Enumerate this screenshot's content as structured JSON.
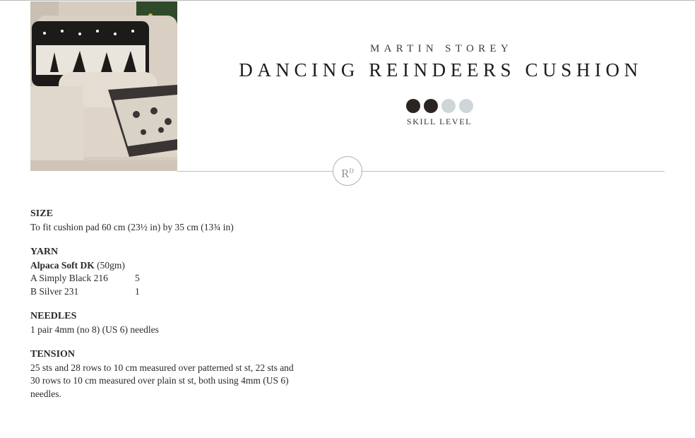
{
  "header": {
    "author": "MARTIN STOREY",
    "title": "DANCING REINDEERS CUSHION",
    "skill_level_label": "SKILL LEVEL",
    "skill_level": 2,
    "skill_level_max": 4
  },
  "logo": {
    "text": "R",
    "superscript": "D"
  },
  "size": {
    "heading": "SIZE",
    "text": "To fit cushion pad 60 cm (23½ in) by 35 cm (13¾ in)"
  },
  "yarn": {
    "heading": "YARN",
    "product": "Alpaca Soft DK",
    "weight": "(50gm)",
    "colors": [
      {
        "name": "A  Simply Black 216",
        "qty": "5"
      },
      {
        "name": "B  Silver 231",
        "qty": "1"
      }
    ]
  },
  "needles": {
    "heading": "NEEDLES",
    "text": "1 pair 4mm (no 8) (US 6) needles"
  },
  "tension": {
    "heading": "TENSION",
    "line1": "25 sts and 28 rows to 10 cm measured over patterned st st, 22 sts and",
    "line2": "30 rows to 10 cm measured over plain st st, both using 4mm (US 6)",
    "line3": "needles."
  },
  "colors": {
    "dot_on": "#2a2523",
    "dot_off": "#cfd6d7",
    "rule": "#b9c2c3"
  }
}
